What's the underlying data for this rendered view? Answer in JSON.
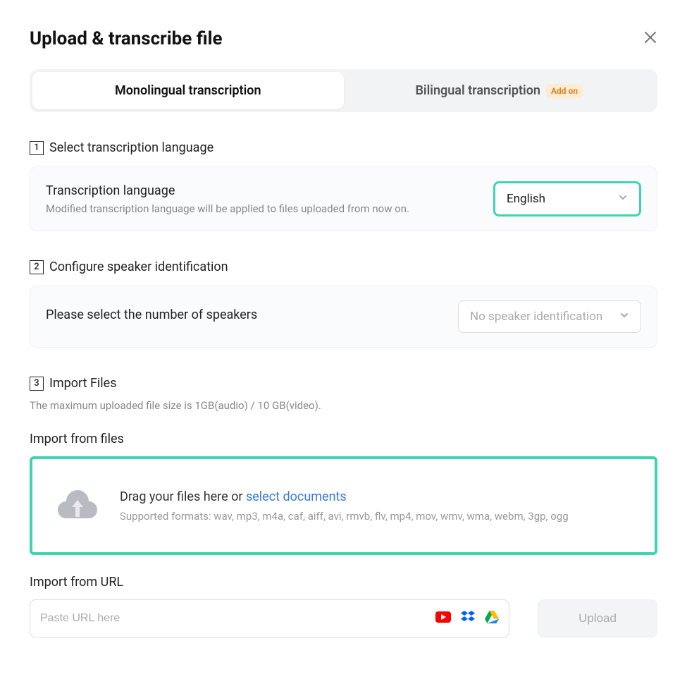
{
  "header": {
    "title": "Upload & transcribe file"
  },
  "tabs": {
    "mono": "Monolingual transcription",
    "bi": "Bilingual transcription",
    "badge": "Add on"
  },
  "step1": {
    "num": "1",
    "label": "Select transcription language",
    "panel_title": "Transcription language",
    "panel_sub": "Modified transcription language will be applied to files uploaded from now on.",
    "selected": "English"
  },
  "step2": {
    "num": "2",
    "label": "Configure speaker identification",
    "panel_title": "Please select the number of speakers",
    "selected": "No speaker identification"
  },
  "step3": {
    "num": "3",
    "label": "Import Files",
    "hint": "The maximum uploaded file size is 1GB(audio) / 10 GB(video).",
    "from_files": "Import from files",
    "drag_prefix": "Drag your files here or  ",
    "drag_link": "select documents",
    "supported": "Supported formats: wav, mp3, m4a, caf, aiff, avi, rmvb, flv, mp4, mov, wmv, wma, webm, 3gp, ogg",
    "from_url": "Import from URL",
    "url_placeholder": "Paste URL here",
    "upload_btn": "Upload"
  }
}
